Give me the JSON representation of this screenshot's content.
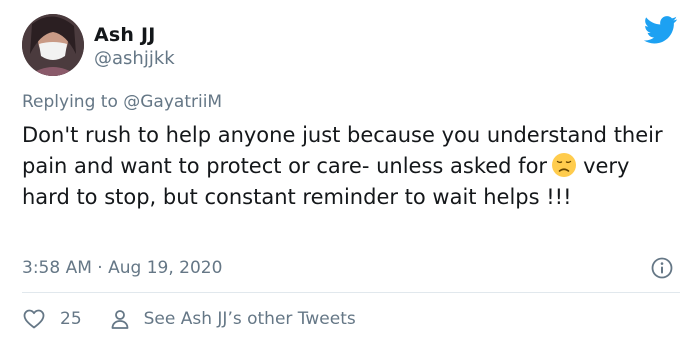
{
  "user": {
    "display_name": "Ash JJ",
    "handle": "@ashjjkk"
  },
  "reply": {
    "prefix": "Replying to",
    "mention": "@GayatriiM"
  },
  "tweet": {
    "text_before_emoji": "Don't rush to help anyone just because you understand their pain and want to protect or care- unless asked for",
    "emoji_icon": "disappointed-face-emoji",
    "text_after_emoji": "very hard to stop, but constant reminder to wait helps !!!"
  },
  "meta": {
    "time": "3:58 AM",
    "separator": "·",
    "date": "Aug 19, 2020"
  },
  "actions": {
    "like_icon": "heart-icon",
    "like_count": "25",
    "profile_icon": "person-icon",
    "other_tweets_label": "See Ash JJ’s other Tweets"
  },
  "colors": {
    "twitter_blue": "#1da1f2",
    "secondary_text": "#657786",
    "primary_text": "#14171a",
    "divider": "#e1e8ed"
  }
}
